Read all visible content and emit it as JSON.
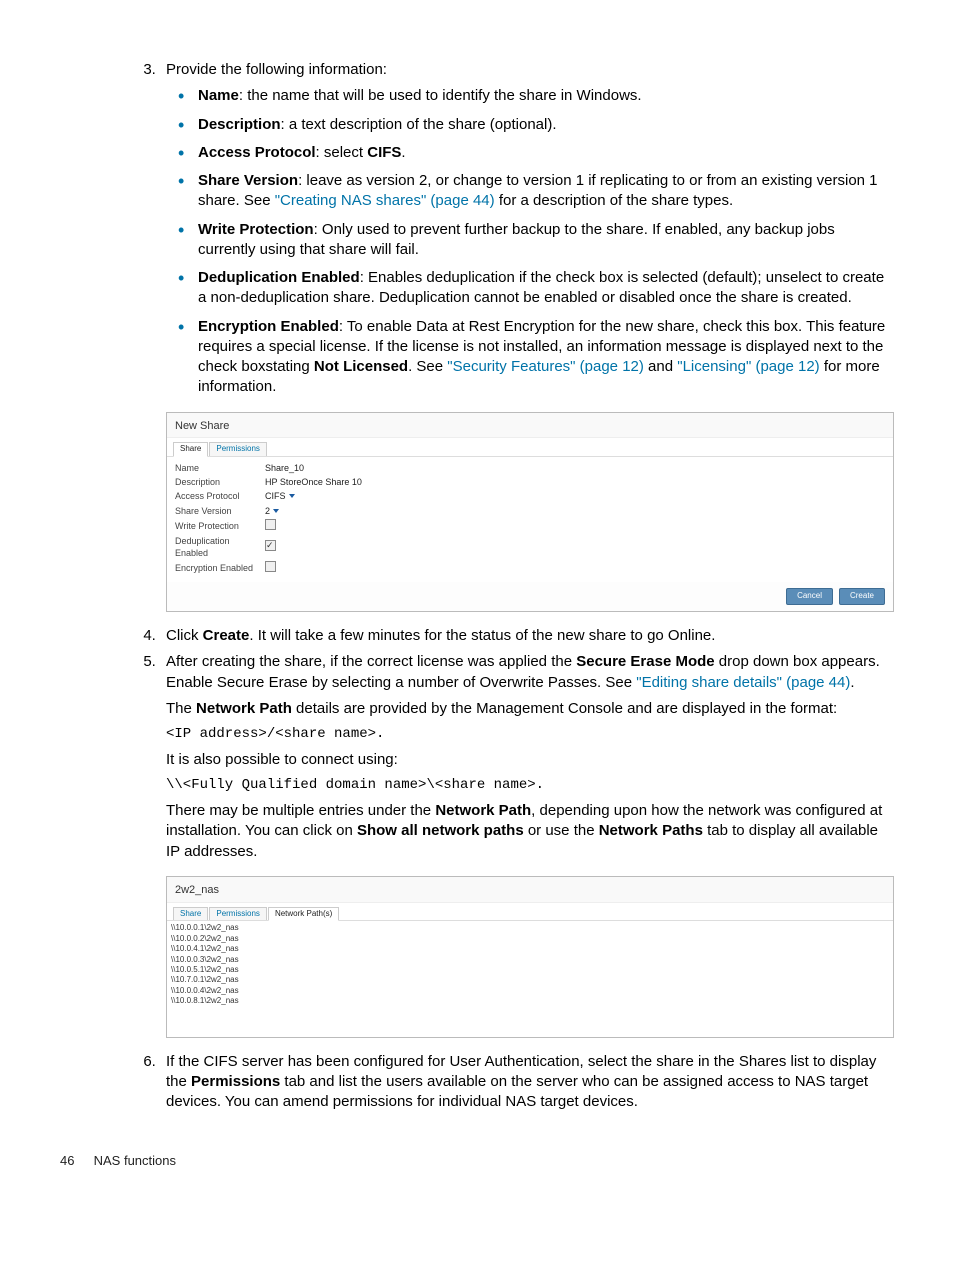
{
  "steps": {
    "s3_intro": "Provide the following information:",
    "bullets": {
      "name_label": "Name",
      "name_text": ": the name that will be used to identify the share in Windows.",
      "desc_label": "Description",
      "desc_text": ": a text description of the share (optional).",
      "ap_label": "Access Protocol",
      "ap_text": ": select ",
      "ap_val": "CIFS",
      "ap_after": ".",
      "sv_label": "Share Version",
      "sv_text1": ": leave as version 2, or change to version 1 if replicating to or from an existing version 1 share. See ",
      "sv_link": "\"Creating NAS shares\" (page 44)",
      "sv_text2": " for a description of the share types.",
      "wp_label": "Write Protection",
      "wp_text": ": Only used to prevent further backup to the share. If enabled, any backup jobs currently using that share will fail.",
      "de_label": "Deduplication Enabled",
      "de_text": ": Enables deduplication if the check box is selected (default); unselect to create a non-deduplication share. Deduplication cannot be enabled or disabled once the share is created.",
      "ee_label": "Encryption Enabled",
      "ee_text1": ": To enable Data at Rest Encryption for the new share, check this box. This feature requires a special license. If the license is not installed, an information message is displayed next to the check boxstating ",
      "ee_nl": "Not Licensed",
      "ee_text2": ". See ",
      "ee_link1": "\"Security Features\" (page 12)",
      "ee_text3": " and ",
      "ee_link2": "\"Licensing\" (page 12)",
      "ee_text4": " for more information."
    },
    "s4_a": "Click ",
    "s4_b": "Create",
    "s4_c": ". It will take a few minutes for the status of the new share to go Online.",
    "s5_a": "After creating the share, if the correct license was applied the ",
    "s5_b": "Secure Erase Mode",
    "s5_c": " drop down box appears. Enable Secure Erase by selecting a number of Overwrite Passes. See ",
    "s5_link": "\"Editing share details\" (page 44)",
    "s5_d": ".",
    "s5_p2a": "The ",
    "s5_p2b": "Network Path",
    "s5_p2c": " details are provided by the Management Console and are displayed in the format:",
    "s5_code1": "<IP address>/<share name>.",
    "s5_p3": "It is also possible to connect using:",
    "s5_code2": "\\\\<Fully Qualified domain name>\\<share name>.",
    "s5_p4a": "There may be multiple entries under the ",
    "s5_p4b": "Network Path",
    "s5_p4c": ", depending upon how the network was configured at installation. You can click on ",
    "s5_p4d": "Show all network paths",
    "s5_p4e": " or use the ",
    "s5_p4f": "Network Paths",
    "s5_p4g": " tab to display all available IP addresses.",
    "s6_a": "If the CIFS server has been configured for User Authentication, select the share in the Shares list to display the ",
    "s6_b": "Permissions",
    "s6_c": " tab and list the users available on the server who can be assigned access to NAS target devices. You can amend permissions for individual NAS target devices."
  },
  "panel1": {
    "title": "New Share",
    "tabs": {
      "share": "Share",
      "perm": "Permissions"
    },
    "rows": {
      "name_l": "Name",
      "name_v": "Share_10",
      "desc_l": "Description",
      "desc_v": "HP StoreOnce Share 10",
      "ap_l": "Access Protocol",
      "ap_v": "CIFS",
      "sv_l": "Share Version",
      "sv_v": "2",
      "wp_l": "Write Protection",
      "de_l": "Deduplication Enabled",
      "ee_l": "Encryption Enabled"
    },
    "btn_cancel": "Cancel",
    "btn_create": "Create"
  },
  "panel2": {
    "title": "2w2_nas",
    "tabs": {
      "share": "Share",
      "perm": "Permissions",
      "np": "Network Path(s)"
    },
    "rows": [
      "\\\\10.0.0.1\\2w2_nas",
      "\\\\10.0.0.2\\2w2_nas",
      "\\\\10.0.4.1\\2w2_nas",
      "\\\\10.0.0.3\\2w2_nas",
      "\\\\10.0.5.1\\2w2_nas",
      "\\\\10.7.0.1\\2w2_nas",
      "\\\\10.0.0.4\\2w2_nas",
      "\\\\10.0.8.1\\2w2_nas"
    ]
  },
  "footer": {
    "page": "46",
    "section": "NAS functions"
  }
}
